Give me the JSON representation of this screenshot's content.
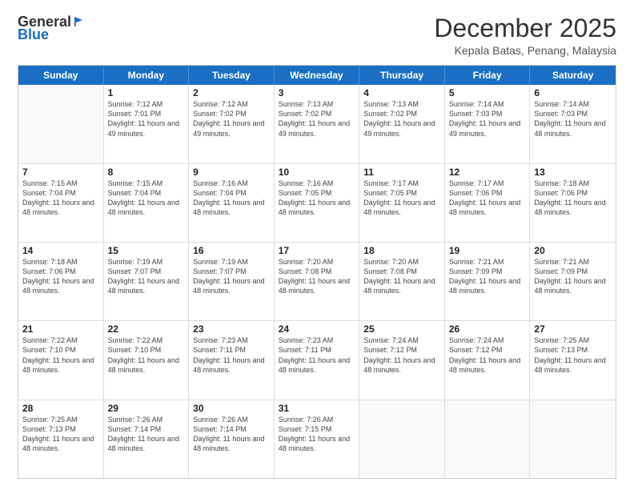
{
  "logo": {
    "general": "General",
    "blue": "Blue"
  },
  "title": "December 2025",
  "location": "Kepala Batas, Penang, Malaysia",
  "days": [
    "Sunday",
    "Monday",
    "Tuesday",
    "Wednesday",
    "Thursday",
    "Friday",
    "Saturday"
  ],
  "weeks": [
    [
      {
        "day": "",
        "sunrise": "",
        "sunset": "",
        "daylight": ""
      },
      {
        "day": "1",
        "sunrise": "Sunrise: 7:12 AM",
        "sunset": "Sunset: 7:01 PM",
        "daylight": "Daylight: 11 hours and 49 minutes."
      },
      {
        "day": "2",
        "sunrise": "Sunrise: 7:12 AM",
        "sunset": "Sunset: 7:02 PM",
        "daylight": "Daylight: 11 hours and 49 minutes."
      },
      {
        "day": "3",
        "sunrise": "Sunrise: 7:13 AM",
        "sunset": "Sunset: 7:02 PM",
        "daylight": "Daylight: 11 hours and 49 minutes."
      },
      {
        "day": "4",
        "sunrise": "Sunrise: 7:13 AM",
        "sunset": "Sunset: 7:02 PM",
        "daylight": "Daylight: 11 hours and 49 minutes."
      },
      {
        "day": "5",
        "sunrise": "Sunrise: 7:14 AM",
        "sunset": "Sunset: 7:03 PM",
        "daylight": "Daylight: 11 hours and 49 minutes."
      },
      {
        "day": "6",
        "sunrise": "Sunrise: 7:14 AM",
        "sunset": "Sunset: 7:03 PM",
        "daylight": "Daylight: 11 hours and 48 minutes."
      }
    ],
    [
      {
        "day": "7",
        "sunrise": "Sunrise: 7:15 AM",
        "sunset": "Sunset: 7:04 PM",
        "daylight": "Daylight: 11 hours and 48 minutes."
      },
      {
        "day": "8",
        "sunrise": "Sunrise: 7:15 AM",
        "sunset": "Sunset: 7:04 PM",
        "daylight": "Daylight: 11 hours and 48 minutes."
      },
      {
        "day": "9",
        "sunrise": "Sunrise: 7:16 AM",
        "sunset": "Sunset: 7:04 PM",
        "daylight": "Daylight: 11 hours and 48 minutes."
      },
      {
        "day": "10",
        "sunrise": "Sunrise: 7:16 AM",
        "sunset": "Sunset: 7:05 PM",
        "daylight": "Daylight: 11 hours and 48 minutes."
      },
      {
        "day": "11",
        "sunrise": "Sunrise: 7:17 AM",
        "sunset": "Sunset: 7:05 PM",
        "daylight": "Daylight: 11 hours and 48 minutes."
      },
      {
        "day": "12",
        "sunrise": "Sunrise: 7:17 AM",
        "sunset": "Sunset: 7:06 PM",
        "daylight": "Daylight: 11 hours and 48 minutes."
      },
      {
        "day": "13",
        "sunrise": "Sunrise: 7:18 AM",
        "sunset": "Sunset: 7:06 PM",
        "daylight": "Daylight: 11 hours and 48 minutes."
      }
    ],
    [
      {
        "day": "14",
        "sunrise": "Sunrise: 7:18 AM",
        "sunset": "Sunset: 7:06 PM",
        "daylight": "Daylight: 11 hours and 48 minutes."
      },
      {
        "day": "15",
        "sunrise": "Sunrise: 7:19 AM",
        "sunset": "Sunset: 7:07 PM",
        "daylight": "Daylight: 11 hours and 48 minutes."
      },
      {
        "day": "16",
        "sunrise": "Sunrise: 7:19 AM",
        "sunset": "Sunset: 7:07 PM",
        "daylight": "Daylight: 11 hours and 48 minutes."
      },
      {
        "day": "17",
        "sunrise": "Sunrise: 7:20 AM",
        "sunset": "Sunset: 7:08 PM",
        "daylight": "Daylight: 11 hours and 48 minutes."
      },
      {
        "day": "18",
        "sunrise": "Sunrise: 7:20 AM",
        "sunset": "Sunset: 7:08 PM",
        "daylight": "Daylight: 11 hours and 48 minutes."
      },
      {
        "day": "19",
        "sunrise": "Sunrise: 7:21 AM",
        "sunset": "Sunset: 7:09 PM",
        "daylight": "Daylight: 11 hours and 48 minutes."
      },
      {
        "day": "20",
        "sunrise": "Sunrise: 7:21 AM",
        "sunset": "Sunset: 7:09 PM",
        "daylight": "Daylight: 11 hours and 48 minutes."
      }
    ],
    [
      {
        "day": "21",
        "sunrise": "Sunrise: 7:22 AM",
        "sunset": "Sunset: 7:10 PM",
        "daylight": "Daylight: 11 hours and 48 minutes."
      },
      {
        "day": "22",
        "sunrise": "Sunrise: 7:22 AM",
        "sunset": "Sunset: 7:10 PM",
        "daylight": "Daylight: 11 hours and 48 minutes."
      },
      {
        "day": "23",
        "sunrise": "Sunrise: 7:23 AM",
        "sunset": "Sunset: 7:11 PM",
        "daylight": "Daylight: 11 hours and 48 minutes."
      },
      {
        "day": "24",
        "sunrise": "Sunrise: 7:23 AM",
        "sunset": "Sunset: 7:11 PM",
        "daylight": "Daylight: 11 hours and 48 minutes."
      },
      {
        "day": "25",
        "sunrise": "Sunrise: 7:24 AM",
        "sunset": "Sunset: 7:12 PM",
        "daylight": "Daylight: 11 hours and 48 minutes."
      },
      {
        "day": "26",
        "sunrise": "Sunrise: 7:24 AM",
        "sunset": "Sunset: 7:12 PM",
        "daylight": "Daylight: 11 hours and 48 minutes."
      },
      {
        "day": "27",
        "sunrise": "Sunrise: 7:25 AM",
        "sunset": "Sunset: 7:13 PM",
        "daylight": "Daylight: 11 hours and 48 minutes."
      }
    ],
    [
      {
        "day": "28",
        "sunrise": "Sunrise: 7:25 AM",
        "sunset": "Sunset: 7:13 PM",
        "daylight": "Daylight: 11 hours and 48 minutes."
      },
      {
        "day": "29",
        "sunrise": "Sunrise: 7:26 AM",
        "sunset": "Sunset: 7:14 PM",
        "daylight": "Daylight: 11 hours and 48 minutes."
      },
      {
        "day": "30",
        "sunrise": "Sunrise: 7:26 AM",
        "sunset": "Sunset: 7:14 PM",
        "daylight": "Daylight: 11 hours and 48 minutes."
      },
      {
        "day": "31",
        "sunrise": "Sunrise: 7:26 AM",
        "sunset": "Sunset: 7:15 PM",
        "daylight": "Daylight: 11 hours and 48 minutes."
      },
      {
        "day": "",
        "sunrise": "",
        "sunset": "",
        "daylight": ""
      },
      {
        "day": "",
        "sunrise": "",
        "sunset": "",
        "daylight": ""
      },
      {
        "day": "",
        "sunrise": "",
        "sunset": "",
        "daylight": ""
      }
    ]
  ]
}
